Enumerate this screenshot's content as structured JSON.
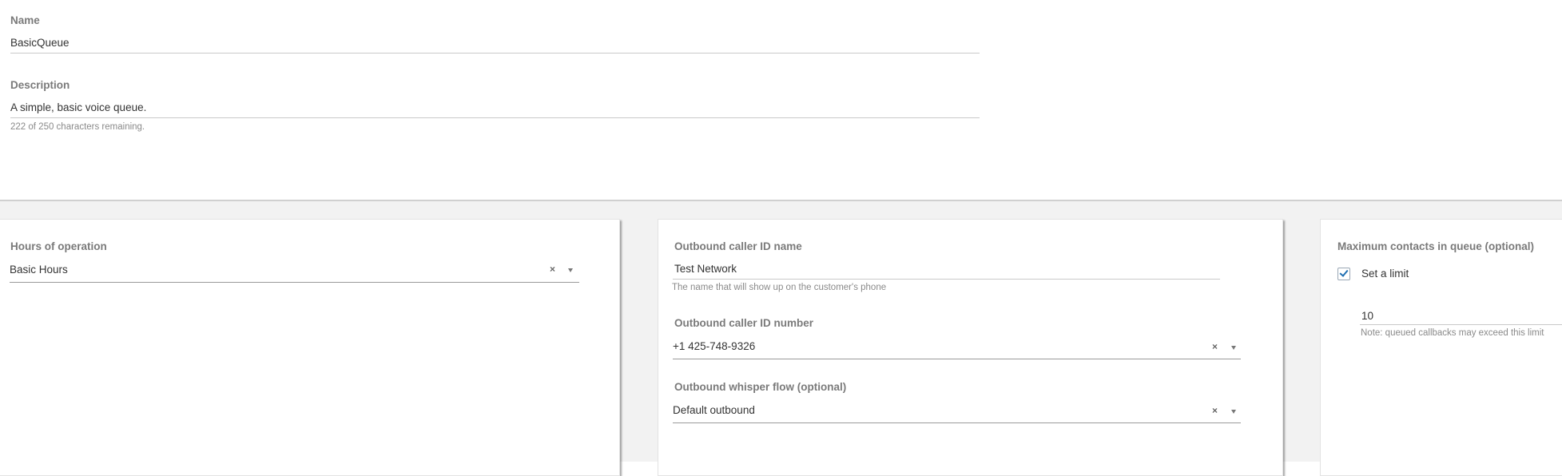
{
  "queue": {
    "name_label": "Name",
    "name_value": "BasicQueue",
    "description_label": "Description",
    "description_value": "A simple, basic voice queue.",
    "description_hint": "222 of 250 characters remaining."
  },
  "hours": {
    "label": "Hours of operation",
    "value": "Basic Hours"
  },
  "outbound": {
    "caller_id_name_label": "Outbound caller ID name",
    "caller_id_name_value": "Test Network",
    "caller_id_name_hint": "The name that will show up on the customer's phone",
    "caller_id_number_label": "Outbound caller ID number",
    "caller_id_number_value": "+1 425-748-9326",
    "whisper_label": "Outbound whisper flow (optional)",
    "whisper_value": "Default outbound"
  },
  "max_contacts": {
    "label": "Maximum contacts in queue (optional)",
    "checkbox_label": "Set a limit",
    "checkbox_checked": true,
    "limit_value": "10",
    "limit_hint": "Note: queued callbacks may exceed this limit"
  },
  "icons": {
    "clear": "×",
    "clear_icon": "close-icon",
    "dropdown_icon": "caret-down-icon",
    "checkmark_icon": "check-icon"
  },
  "colors": {
    "accent": "#1f6fb2",
    "label": "#7a7a7a",
    "background_panel": "#f2f2f2"
  }
}
